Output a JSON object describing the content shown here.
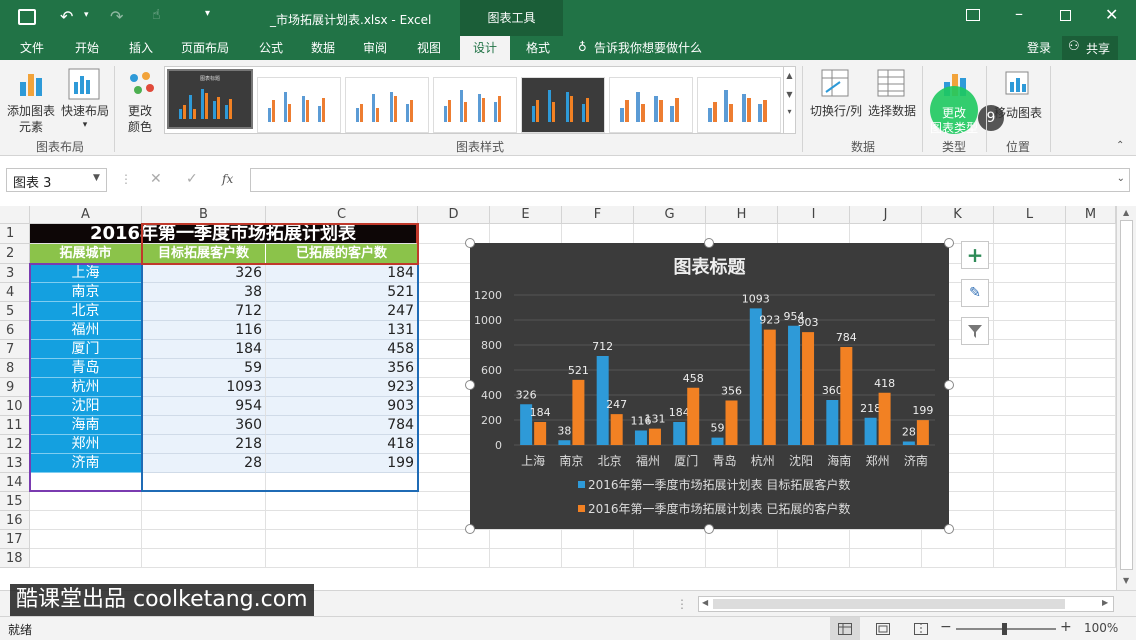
{
  "window": {
    "filename": "_市场拓展计划表.xlsx - Excel",
    "context_group": "图表工具"
  },
  "tabs": [
    "文件",
    "开始",
    "插入",
    "页面布局",
    "公式",
    "数据",
    "审阅",
    "视图",
    "设计",
    "格式"
  ],
  "tell_me": "告诉我你想要做什么",
  "account": {
    "login": "登录",
    "share": "共享"
  },
  "ribbon": {
    "add_element": "添加图表元素",
    "add_element_l1": "添加图表",
    "add_element_l2": "元素",
    "quick_layout": "快速布局",
    "change_color_l1": "更改",
    "change_color_l2": "颜色",
    "group_layout": "图表布局",
    "group_styles": "图表样式",
    "switch_rowcol": "切换行/列",
    "select_data": "选择数据",
    "group_data": "数据",
    "change_type_l1": "更改",
    "change_type_l2": "图表类型",
    "group_type": "类型",
    "move_chart": "移动图表",
    "group_location": "位置",
    "step_badge": "9",
    "gallery_title": "图表标题"
  },
  "formula": {
    "namebox": "图表 3",
    "fx": "fx",
    "value": ""
  },
  "columns": [
    "A",
    "B",
    "C",
    "D",
    "E",
    "F",
    "G",
    "H",
    "I",
    "J",
    "K",
    "L",
    "M"
  ],
  "rows": [
    "1",
    "2",
    "3",
    "4",
    "5",
    "6",
    "7",
    "8",
    "9",
    "10",
    "11",
    "12",
    "13",
    "14",
    "15",
    "16",
    "17",
    "18"
  ],
  "sheet": {
    "title": "2016年第一季度市场拓展计划表",
    "headers": [
      "拓展城市",
      "目标拓展客户数",
      "已拓展的客户数"
    ],
    "data": [
      [
        "上海",
        "326",
        "184"
      ],
      [
        "南京",
        "38",
        "521"
      ],
      [
        "北京",
        "712",
        "247"
      ],
      [
        "福州",
        "116",
        "131"
      ],
      [
        "厦门",
        "184",
        "458"
      ],
      [
        "青岛",
        "59",
        "356"
      ],
      [
        "杭州",
        "1093",
        "923"
      ],
      [
        "沈阳",
        "954",
        "903"
      ],
      [
        "海南",
        "360",
        "784"
      ],
      [
        "郑州",
        "218",
        "418"
      ],
      [
        "济南",
        "28",
        "199"
      ]
    ]
  },
  "chart_data": {
    "type": "bar",
    "title": "图表标题",
    "categories": [
      "上海",
      "南京",
      "北京",
      "福州",
      "厦门",
      "青岛",
      "杭州",
      "沈阳",
      "海南",
      "郑州",
      "济南"
    ],
    "series": [
      {
        "name": "2016年第一季度市场拓展计划表 目标拓展客户数",
        "values": [
          326,
          38,
          712,
          116,
          184,
          59,
          1093,
          954,
          360,
          218,
          28
        ],
        "color": "#2e9ad8"
      },
      {
        "name": "2016年第一季度市场拓展计划表 已拓展的客户数",
        "values": [
          184,
          521,
          247,
          131,
          458,
          356,
          923,
          903,
          784,
          418,
          199
        ],
        "color": "#f28123"
      }
    ],
    "yticks": [
      "0",
      "200",
      "400",
      "600",
      "800",
      "1000",
      "1200"
    ],
    "ylim": [
      0,
      1200
    ],
    "legend_position": "bottom",
    "grid": true
  },
  "status": {
    "ready": "就绪",
    "zoom": "100%",
    "minus": "−",
    "plus": "+"
  },
  "watermark": "酷课堂出品 coolketang.com",
  "colors": {
    "excel_green": "#217346",
    "chart_bg": "#3b3b3b",
    "highlight": "#1ec95f"
  }
}
